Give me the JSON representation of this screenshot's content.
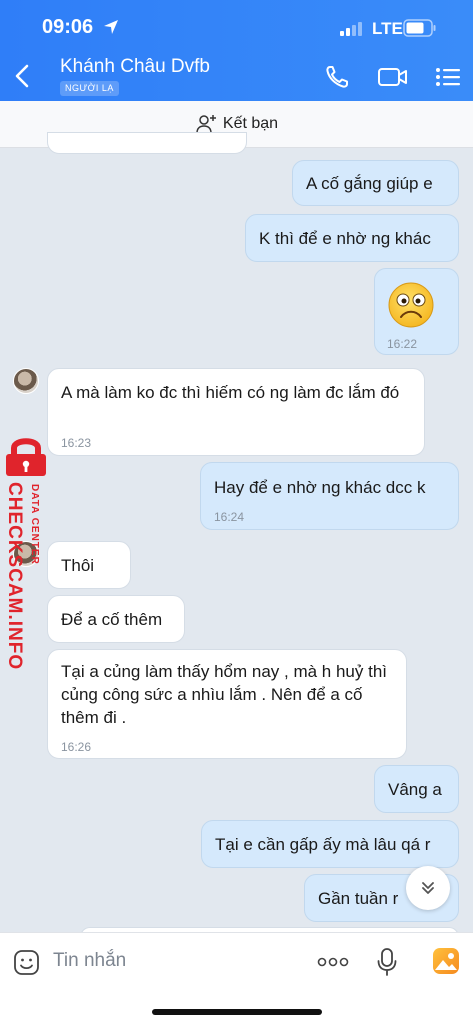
{
  "status": {
    "time": "09:06",
    "network": "LTE"
  },
  "header": {
    "contact_name": "Khánh Châu Dvfb",
    "badge": "NGƯỜI LẠ"
  },
  "friend_bar": {
    "label": "Kết bạn"
  },
  "messages": [
    {
      "side": "out",
      "text": "A cố gắng giúp e"
    },
    {
      "side": "out",
      "text": "K thì để e nhờ ng khác"
    },
    {
      "side": "out",
      "sticker": "sad-face",
      "time": "16:22"
    },
    {
      "side": "in",
      "text": "A mà làm ko đc thì hiếm có ng làm đc lắm đó",
      "time": "16:23"
    },
    {
      "side": "out",
      "text": "Hay để e nhờ ng khác dcc k",
      "time": "16:24"
    },
    {
      "side": "in",
      "text": "Thôi"
    },
    {
      "side": "in",
      "text": "Để a cố thêm"
    },
    {
      "side": "in",
      "text": "Tại a củng làm thấy hổm nay , mà h huỷ thì củng công sức a nhìu lắm . Nên để a cố thêm đi .",
      "time": "16:26"
    },
    {
      "side": "out",
      "text": "Vâng a"
    },
    {
      "side": "out",
      "text": "Tại e cần gấp ấy mà lâu qá r"
    },
    {
      "side": "out",
      "text": "Gần tuần r"
    }
  ],
  "watermark": {
    "line1": "DATA CENTER",
    "line2": "CHECKSCAM.INFO"
  },
  "input": {
    "placeholder": "Tin nhắn"
  },
  "colors": {
    "header": "#2f7ef8",
    "outgoing": "#d5e9fc",
    "incoming": "#ffffff",
    "watermark": "#e0242c"
  }
}
